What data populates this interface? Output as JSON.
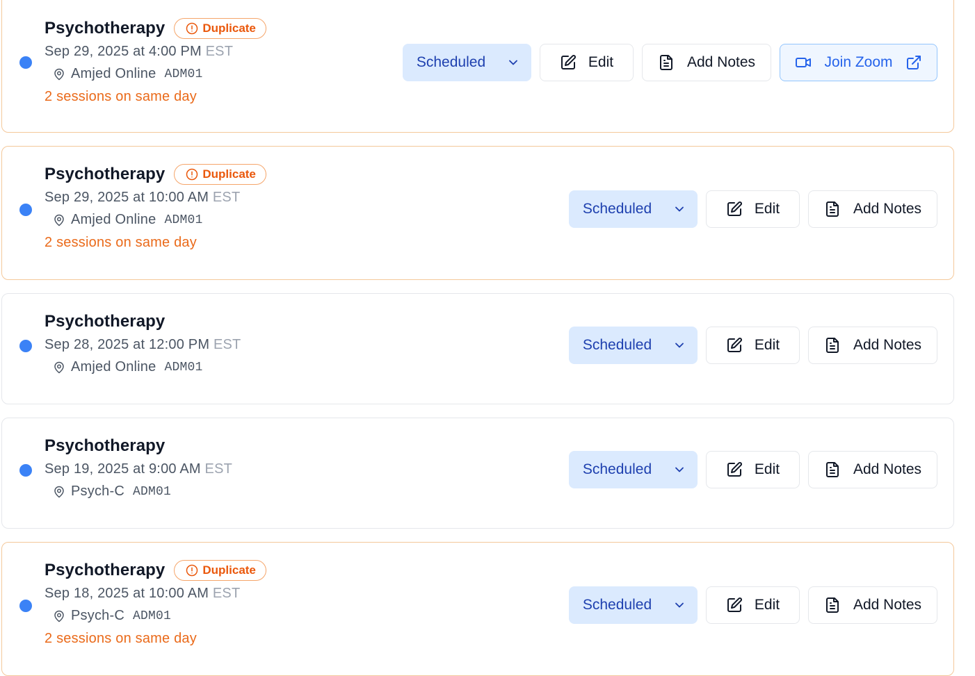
{
  "sessions": [
    {
      "title": "Psychotherapy",
      "badge": "Duplicate",
      "date": "Sep 29, 2025 at 4:00 PM",
      "tz": "EST",
      "location": "Amjed Online",
      "code": "ADM01",
      "same_day": "2 sessions on same day",
      "status": "Scheduled",
      "edit": "Edit",
      "notes": "Add Notes",
      "zoom": "Join Zoom"
    },
    {
      "title": "Psychotherapy",
      "badge": "Duplicate",
      "date": "Sep 29, 2025 at 10:00 AM",
      "tz": "EST",
      "location": "Amjed Online",
      "code": "ADM01",
      "same_day": "2 sessions on same day",
      "status": "Scheduled",
      "edit": "Edit",
      "notes": "Add Notes"
    },
    {
      "title": "Psychotherapy",
      "date": "Sep 28, 2025 at 12:00 PM",
      "tz": "EST",
      "location": "Amjed Online",
      "code": "ADM01",
      "status": "Scheduled",
      "edit": "Edit",
      "notes": "Add Notes"
    },
    {
      "title": "Psychotherapy",
      "date": "Sep 19, 2025 at 9:00 AM",
      "tz": "EST",
      "location": "Psych-C",
      "code": "ADM01",
      "status": "Scheduled",
      "edit": "Edit",
      "notes": "Add Notes"
    },
    {
      "title": "Psychotherapy",
      "badge": "Duplicate",
      "date": "Sep 18, 2025 at 10:00 AM",
      "tz": "EST",
      "location": "Psych-C",
      "code": "ADM01",
      "same_day": "2 sessions on same day",
      "status": "Scheduled",
      "edit": "Edit",
      "notes": "Add Notes"
    }
  ],
  "icons": {
    "status_dot": "status-dot",
    "badge": "alert-circle-icon",
    "location": "map-pin-icon",
    "status_dropdown": "chevron-down-icon",
    "edit": "edit-icon",
    "notes": "file-text-icon",
    "zoom": "video-icon",
    "external": "external-link-icon"
  },
  "colors": {
    "dot": "#3b82f6",
    "duplicate": "#ea580c",
    "status_bg": "#dbeafe",
    "status_text": "#1e40af",
    "zoom_text": "#2563eb",
    "duplicate_border": "#f4c89a"
  }
}
